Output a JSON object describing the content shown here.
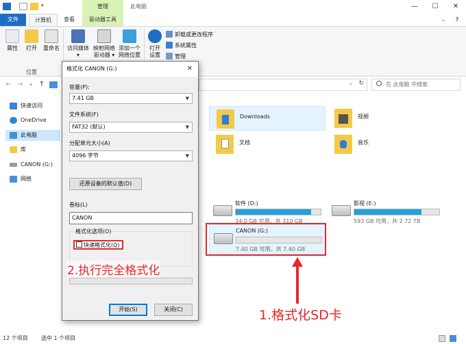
{
  "titlebar": {
    "context_tab": "管理",
    "window_title": "此电脑",
    "minimize": "—",
    "maximize": "☐",
    "close": "✕"
  },
  "ribbon": {
    "tabs": [
      "文件",
      "计算机",
      "查看",
      "驱动器工具"
    ],
    "help": "?",
    "location_group_label": "位置",
    "buttons": {
      "properties": "属性",
      "open": "打开",
      "rename": "重命名",
      "access_media_1": "访问媒体",
      "access_media_2": "▾",
      "map_drive_1": "映射网络",
      "map_drive_2": "驱动器 ▾",
      "add_location_1": "添加一个",
      "add_location_2": "网络位置",
      "open_settings_1": "打开",
      "open_settings_2": "设置"
    },
    "system_items": [
      "卸载或更改程序",
      "系统属性",
      "管理"
    ]
  },
  "address": {
    "search_placeholder": "在 此电脑 中搜索",
    "back": "←",
    "forward": "→",
    "up": "↑"
  },
  "nav": {
    "items": [
      "快速访问",
      "OneDrive",
      "此电脑",
      "库",
      "CANON (G:)",
      "网络"
    ]
  },
  "folders": [
    {
      "name": "Downloads"
    },
    {
      "name": "视频"
    },
    {
      "name": "文档"
    },
    {
      "name": "音乐"
    }
  ],
  "drives": [
    {
      "name": "软件 (D:)",
      "info": "34.0 GB 可用，共 310 GB",
      "used_fraction": 0.89
    },
    {
      "name": "影视 (E:)",
      "info": "593 GB 可用，共 2.72 TB",
      "used_fraction": 0.79
    },
    {
      "name": "CANON (G:)",
      "info": "7.40 GB 可用，共 7.40 GB",
      "used_fraction": 0.0
    }
  ],
  "status": {
    "count": "12 个项目",
    "selected": "选中 1 个项目"
  },
  "dialog": {
    "title": "格式化 CANON (G:)",
    "close": "✕",
    "capacity_label": "容量(P):",
    "capacity_value": "7.41 GB",
    "filesystem_label": "文件系统(F)",
    "filesystem_value": "FAT32 (默认)",
    "alloc_label": "分配单元大小(A)",
    "alloc_value": "4096 字节",
    "restore_defaults": "还原设备的默认值(D)",
    "volume_label": "卷标(L)",
    "volume_value": "CANON",
    "options_legend": "格式化选项(O)",
    "quick_format": "快速格式化(Q)",
    "quick_format_checked": false,
    "start_button": "开始(S)",
    "close_button": "关闭(C)"
  },
  "annotations": {
    "step1": "1.格式化SD卡",
    "step2": "2.执行完全格式化",
    "color": "#e8262b"
  }
}
